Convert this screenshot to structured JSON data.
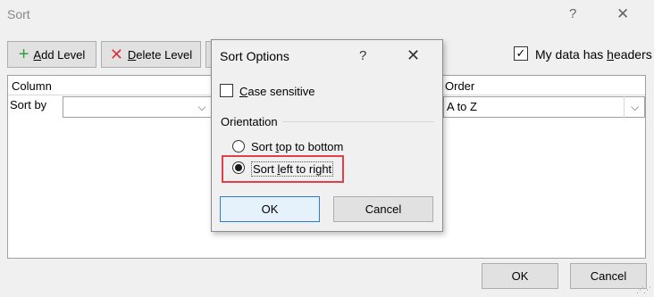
{
  "dialog": {
    "title": "Sort",
    "help_glyph": "?",
    "close_glyph": "✕"
  },
  "toolbar": {
    "add_level": {
      "pre": "",
      "key": "A",
      "post": "dd Level"
    },
    "delete_level": {
      "pre": "",
      "key": "D",
      "post": "elete Level"
    },
    "headers_checkbox": {
      "checked": true,
      "pre": "My data has ",
      "key": "h",
      "post": "eaders"
    }
  },
  "grid": {
    "column_header": "Column",
    "order_header": "Order",
    "sort_by_label": "Sort by",
    "sort_by_value": "",
    "order_value": "A to Z"
  },
  "footer": {
    "ok_label": "OK",
    "cancel_label": "Cancel"
  },
  "sort_options": {
    "title": "Sort Options",
    "help_glyph": "?",
    "close_glyph": "✕",
    "case_sensitive": {
      "checked": false,
      "key": "C",
      "post": "ase sensitive"
    },
    "orientation_label": "Orientation",
    "top_to_bottom": {
      "selected": false,
      "pre": "Sort ",
      "key": "t",
      "post": "op to bottom"
    },
    "left_to_right": {
      "selected": true,
      "pre": "Sort ",
      "key": "l",
      "post": "eft to right"
    },
    "ok_label": "OK",
    "cancel_label": "Cancel",
    "highlight_color": "#e0404a"
  },
  "icons": {
    "add": "plus-icon",
    "delete": "x-icon",
    "dropdown": "chevron-down-icon"
  },
  "colors": {
    "add_icon": "#2e9e3e",
    "delete_icon": "#d9343f",
    "ok_focus_border": "#2d7bd6"
  }
}
